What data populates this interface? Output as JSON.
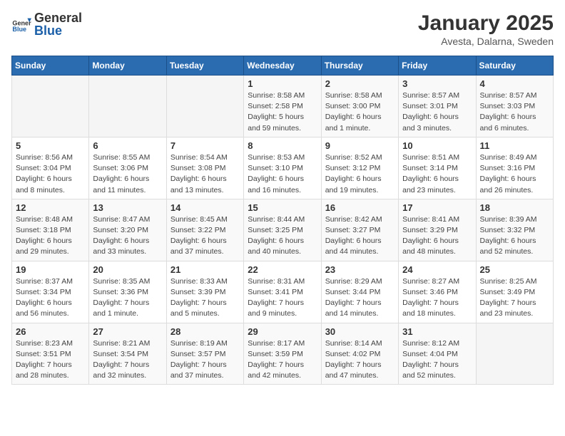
{
  "header": {
    "logo": {
      "general": "General",
      "blue": "Blue"
    },
    "title": "January 2025",
    "subtitle": "Avesta, Dalarna, Sweden"
  },
  "days_of_week": [
    "Sunday",
    "Monday",
    "Tuesday",
    "Wednesday",
    "Thursday",
    "Friday",
    "Saturday"
  ],
  "weeks": [
    [
      {
        "day": null,
        "sunrise": null,
        "sunset": null,
        "daylight": null
      },
      {
        "day": null,
        "sunrise": null,
        "sunset": null,
        "daylight": null
      },
      {
        "day": null,
        "sunrise": null,
        "sunset": null,
        "daylight": null
      },
      {
        "day": "1",
        "sunrise": "8:58 AM",
        "sunset": "2:58 PM",
        "daylight": "5 hours and 59 minutes."
      },
      {
        "day": "2",
        "sunrise": "8:58 AM",
        "sunset": "3:00 PM",
        "daylight": "6 hours and 1 minute."
      },
      {
        "day": "3",
        "sunrise": "8:57 AM",
        "sunset": "3:01 PM",
        "daylight": "6 hours and 3 minutes."
      },
      {
        "day": "4",
        "sunrise": "8:57 AM",
        "sunset": "3:03 PM",
        "daylight": "6 hours and 6 minutes."
      }
    ],
    [
      {
        "day": "5",
        "sunrise": "8:56 AM",
        "sunset": "3:04 PM",
        "daylight": "6 hours and 8 minutes."
      },
      {
        "day": "6",
        "sunrise": "8:55 AM",
        "sunset": "3:06 PM",
        "daylight": "6 hours and 11 minutes."
      },
      {
        "day": "7",
        "sunrise": "8:54 AM",
        "sunset": "3:08 PM",
        "daylight": "6 hours and 13 minutes."
      },
      {
        "day": "8",
        "sunrise": "8:53 AM",
        "sunset": "3:10 PM",
        "daylight": "6 hours and 16 minutes."
      },
      {
        "day": "9",
        "sunrise": "8:52 AM",
        "sunset": "3:12 PM",
        "daylight": "6 hours and 19 minutes."
      },
      {
        "day": "10",
        "sunrise": "8:51 AM",
        "sunset": "3:14 PM",
        "daylight": "6 hours and 23 minutes."
      },
      {
        "day": "11",
        "sunrise": "8:49 AM",
        "sunset": "3:16 PM",
        "daylight": "6 hours and 26 minutes."
      }
    ],
    [
      {
        "day": "12",
        "sunrise": "8:48 AM",
        "sunset": "3:18 PM",
        "daylight": "6 hours and 29 minutes."
      },
      {
        "day": "13",
        "sunrise": "8:47 AM",
        "sunset": "3:20 PM",
        "daylight": "6 hours and 33 minutes."
      },
      {
        "day": "14",
        "sunrise": "8:45 AM",
        "sunset": "3:22 PM",
        "daylight": "6 hours and 37 minutes."
      },
      {
        "day": "15",
        "sunrise": "8:44 AM",
        "sunset": "3:25 PM",
        "daylight": "6 hours and 40 minutes."
      },
      {
        "day": "16",
        "sunrise": "8:42 AM",
        "sunset": "3:27 PM",
        "daylight": "6 hours and 44 minutes."
      },
      {
        "day": "17",
        "sunrise": "8:41 AM",
        "sunset": "3:29 PM",
        "daylight": "6 hours and 48 minutes."
      },
      {
        "day": "18",
        "sunrise": "8:39 AM",
        "sunset": "3:32 PM",
        "daylight": "6 hours and 52 minutes."
      }
    ],
    [
      {
        "day": "19",
        "sunrise": "8:37 AM",
        "sunset": "3:34 PM",
        "daylight": "6 hours and 56 minutes."
      },
      {
        "day": "20",
        "sunrise": "8:35 AM",
        "sunset": "3:36 PM",
        "daylight": "7 hours and 1 minute."
      },
      {
        "day": "21",
        "sunrise": "8:33 AM",
        "sunset": "3:39 PM",
        "daylight": "7 hours and 5 minutes."
      },
      {
        "day": "22",
        "sunrise": "8:31 AM",
        "sunset": "3:41 PM",
        "daylight": "7 hours and 9 minutes."
      },
      {
        "day": "23",
        "sunrise": "8:29 AM",
        "sunset": "3:44 PM",
        "daylight": "7 hours and 14 minutes."
      },
      {
        "day": "24",
        "sunrise": "8:27 AM",
        "sunset": "3:46 PM",
        "daylight": "7 hours and 18 minutes."
      },
      {
        "day": "25",
        "sunrise": "8:25 AM",
        "sunset": "3:49 PM",
        "daylight": "7 hours and 23 minutes."
      }
    ],
    [
      {
        "day": "26",
        "sunrise": "8:23 AM",
        "sunset": "3:51 PM",
        "daylight": "7 hours and 28 minutes."
      },
      {
        "day": "27",
        "sunrise": "8:21 AM",
        "sunset": "3:54 PM",
        "daylight": "7 hours and 32 minutes."
      },
      {
        "day": "28",
        "sunrise": "8:19 AM",
        "sunset": "3:57 PM",
        "daylight": "7 hours and 37 minutes."
      },
      {
        "day": "29",
        "sunrise": "8:17 AM",
        "sunset": "3:59 PM",
        "daylight": "7 hours and 42 minutes."
      },
      {
        "day": "30",
        "sunrise": "8:14 AM",
        "sunset": "4:02 PM",
        "daylight": "7 hours and 47 minutes."
      },
      {
        "day": "31",
        "sunrise": "8:12 AM",
        "sunset": "4:04 PM",
        "daylight": "7 hours and 52 minutes."
      },
      {
        "day": null,
        "sunrise": null,
        "sunset": null,
        "daylight": null
      }
    ]
  ],
  "labels": {
    "sunrise": "Sunrise:",
    "sunset": "Sunset:",
    "daylight": "Daylight:"
  }
}
